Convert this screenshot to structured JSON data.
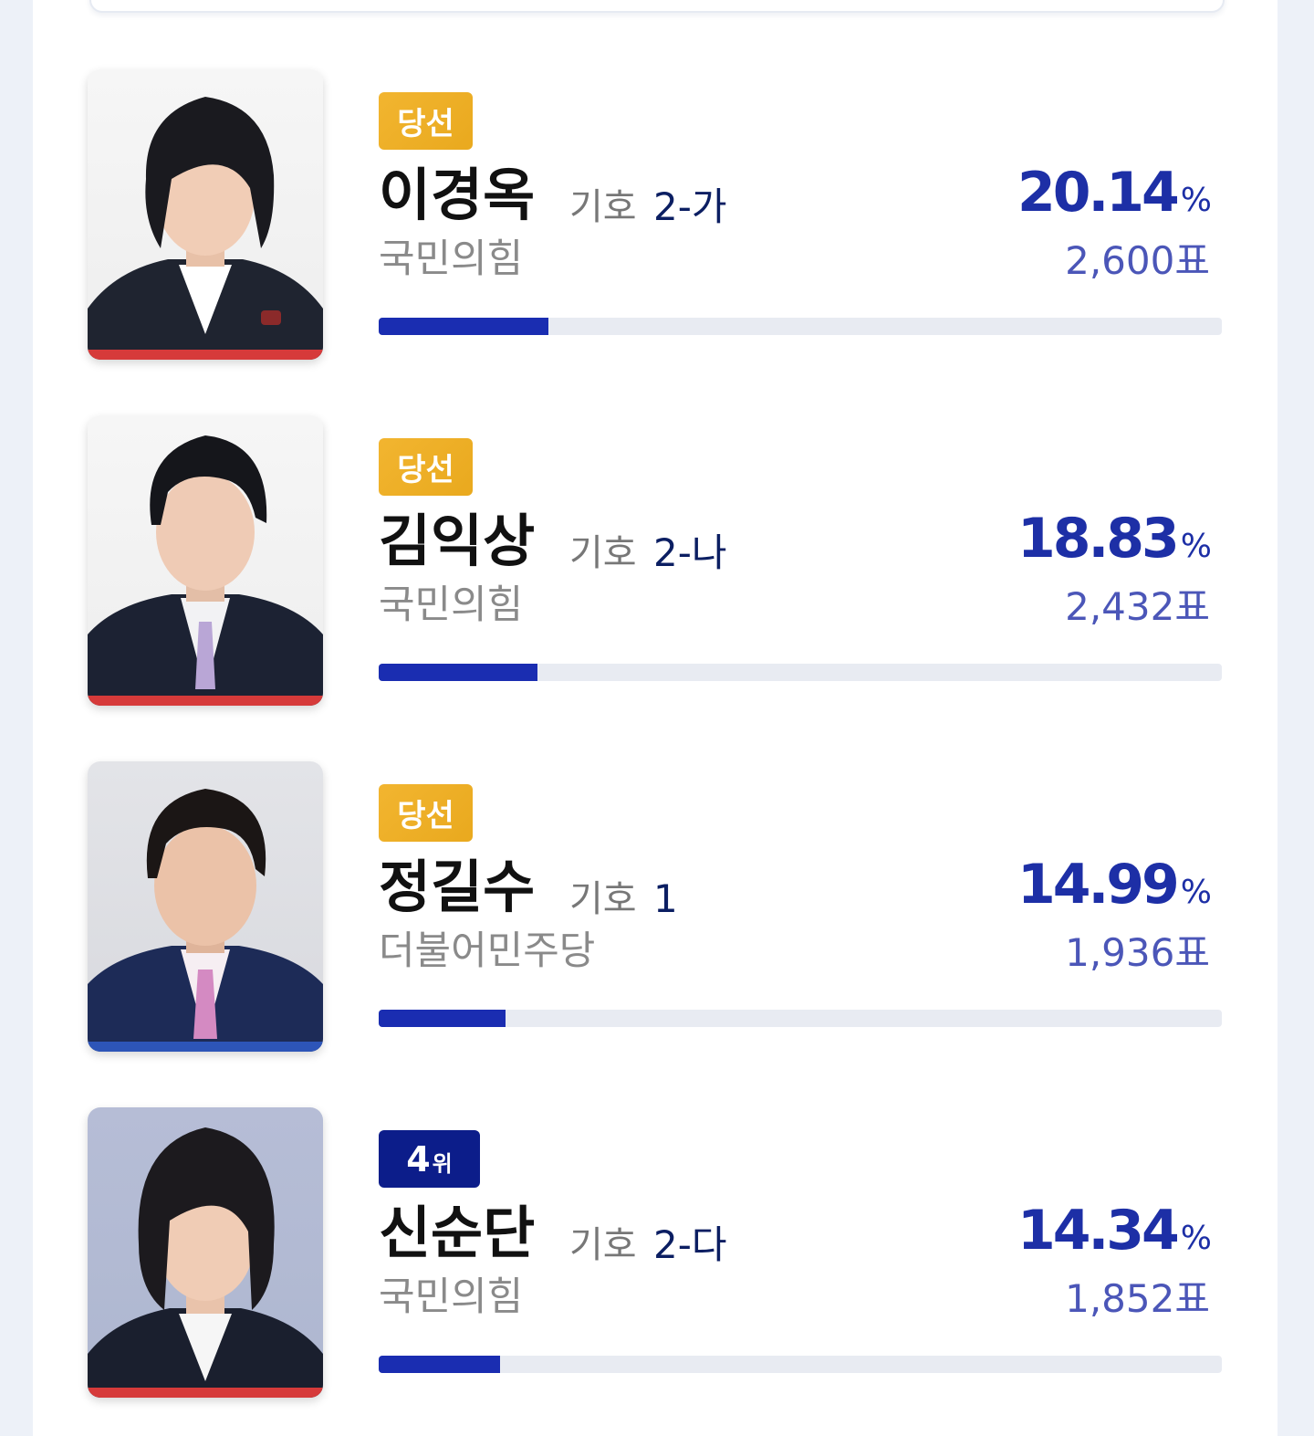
{
  "colors": {
    "ppp_red": "#d63a3a",
    "dp_blue": "#2d55b8",
    "elected_gold": "#f0b12a",
    "rank_navy": "#0c1d8a",
    "bar_blue": "#1a2db1",
    "percent_blue": "#1d2fa6"
  },
  "labels": {
    "number_prefix": "기호",
    "percent_unit": "%"
  },
  "candidates": [
    {
      "badge": "당선",
      "badge_type": "elected",
      "name": "이경옥",
      "number": "2-가",
      "party": "국민의힘",
      "percent": "20.14",
      "votes": "2,600표",
      "share": 20.14,
      "party_color": "#d63a3a",
      "photo_icon": "woman-portrait-icon"
    },
    {
      "badge": "당선",
      "badge_type": "elected",
      "name": "김익상",
      "number": "2-나",
      "party": "국민의힘",
      "percent": "18.83",
      "votes": "2,432표",
      "share": 18.83,
      "party_color": "#d63a3a",
      "photo_icon": "man-portrait-icon"
    },
    {
      "badge": "당선",
      "badge_type": "elected",
      "name": "정길수",
      "number": "1",
      "party": "더불어민주당",
      "percent": "14.99",
      "votes": "1,936표",
      "share": 14.99,
      "party_color": "#2d55b8",
      "photo_icon": "man-portrait-icon"
    },
    {
      "badge_num": "4",
      "badge_unit": "위",
      "badge_type": "rank",
      "name": "신순단",
      "number": "2-다",
      "party": "국민의힘",
      "percent": "14.34",
      "votes": "1,852표",
      "share": 14.34,
      "party_color": "#d63a3a",
      "photo_icon": "woman-portrait-icon"
    }
  ]
}
